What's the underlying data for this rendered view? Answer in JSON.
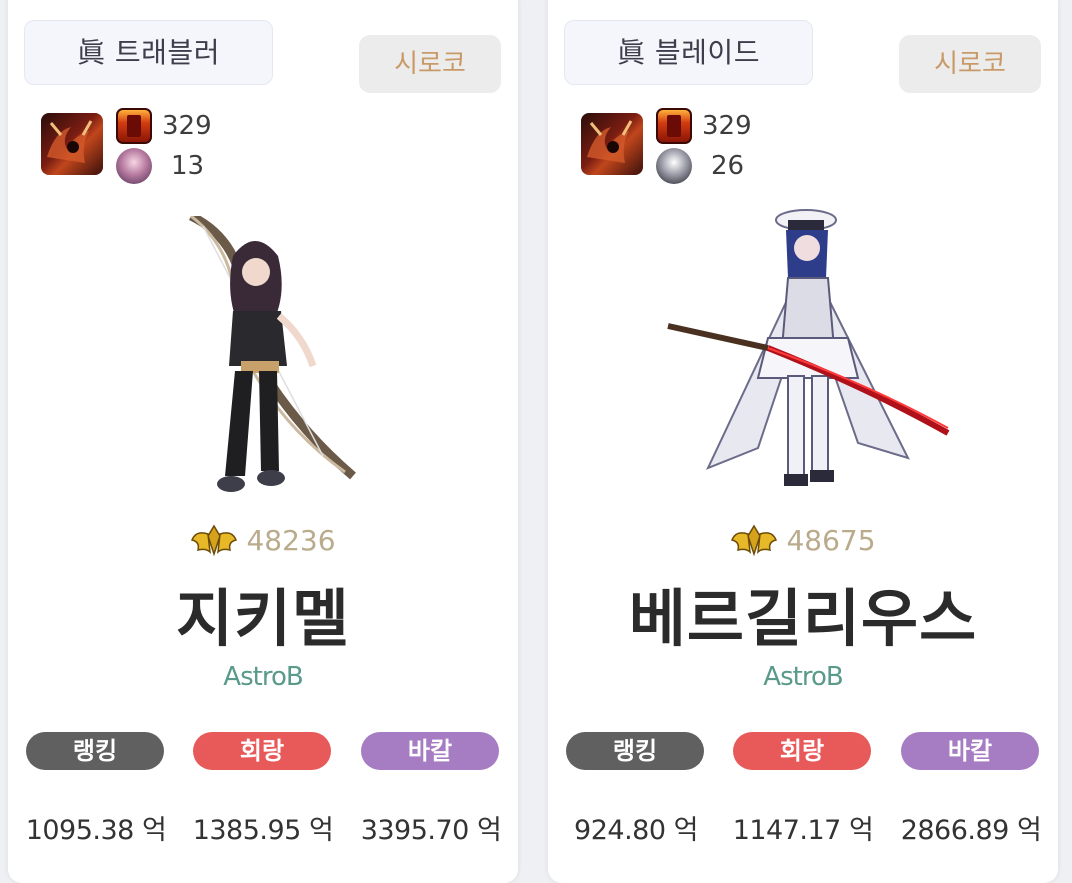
{
  "cards": [
    {
      "job": "眞 트래블러",
      "server": "시로코",
      "stat1": "329",
      "stat2": "13",
      "fame": "48236",
      "name": "지키멜",
      "guild": "AstroB",
      "tags": [
        "랭킹",
        "회랑",
        "바칼"
      ],
      "values": [
        "1095.38 억",
        "1385.95 억",
        "3395.70 억"
      ]
    },
    {
      "job": "眞 블레이드",
      "server": "시로코",
      "stat1": "329",
      "stat2": "26",
      "fame": "48675",
      "name": "베르길리우스",
      "guild": "AstroB",
      "tags": [
        "랭킹",
        "회랑",
        "바칼"
      ],
      "values": [
        "924.80 억",
        "1147.17 억",
        "2866.89 억"
      ]
    }
  ],
  "colors": {
    "rank_tag": "#606060",
    "hoe_tag": "#e85a5a",
    "bak_tag": "#a67cc2",
    "server_text": "#c99a67",
    "fame_text": "#b9ab8c",
    "guild_text": "#5a9a8a"
  },
  "icons": {
    "emblem": "demon-emblem-icon",
    "stat1": "red-chest-icon",
    "stat2": "buddy-portrait-icon",
    "fame": "gold-fame-wings-icon"
  }
}
